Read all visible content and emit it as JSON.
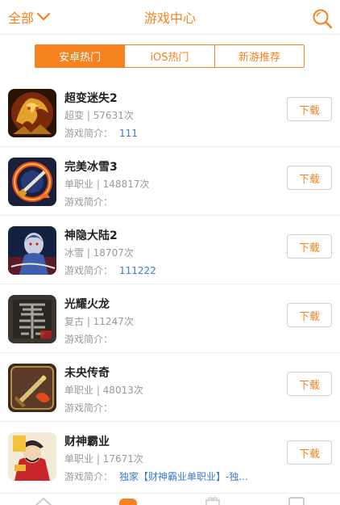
{
  "header": {
    "category_label": "全部",
    "title": "游戏中心"
  },
  "tabs": [
    {
      "label": "安卓热门",
      "active": true
    },
    {
      "label": "iOS热门",
      "active": false
    },
    {
      "label": "新游推荐",
      "active": false
    }
  ],
  "games": [
    {
      "name": "超变迷失2",
      "meta": "超变 | 57631次",
      "intro_label": "游戏简介：",
      "intro": "111",
      "button": "下载",
      "icon": "dragon-gold-game-icon"
    },
    {
      "name": "完美冰雪3",
      "meta": "单职业 | 148817次",
      "intro_label": "游戏简介：",
      "intro": "",
      "button": "下载",
      "icon": "fire-ring-game-icon"
    },
    {
      "name": "神隐大陆2",
      "meta": "冰雪 | 18707次",
      "intro_label": "游戏简介：",
      "intro": "111222",
      "button": "下载",
      "icon": "warrior-blue-game-icon"
    },
    {
      "name": "光耀火龙",
      "meta": "复古 | 11247次",
      "intro_label": "游戏简介：",
      "intro": "",
      "button": "下载",
      "icon": "dragon-character-game-icon"
    },
    {
      "name": "未央传奇",
      "meta": "单职业 | 48013次",
      "intro_label": "游戏简介：",
      "intro": "",
      "button": "下载",
      "icon": "golden-sword-game-icon"
    },
    {
      "name": "财神霸业",
      "meta": "单职业 | 17671次",
      "intro_label": "游戏简介：",
      "intro": "独家【财神霸业单职业】-独...",
      "button": "下载",
      "icon": "fortune-god-game-icon"
    }
  ],
  "colors": {
    "accent": "#f5821f",
    "link": "#3b7ad6",
    "muted": "#999999"
  }
}
